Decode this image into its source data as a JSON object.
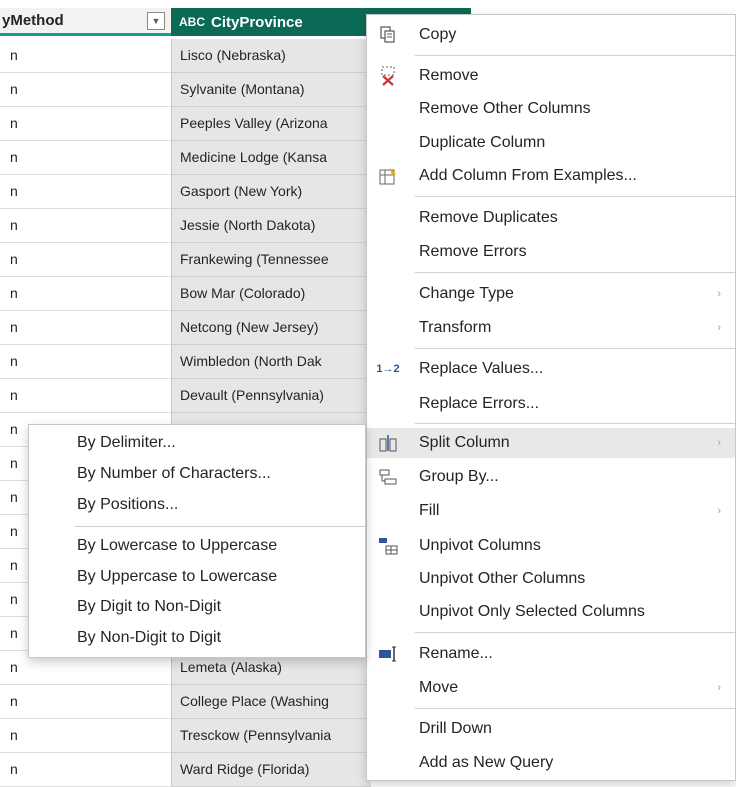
{
  "columns": {
    "col1_header": "yMethod",
    "col2_header": "CityProvince",
    "col2_type_icon": "ABC",
    "dropdown_glyph": "▼"
  },
  "rows": [
    {
      "c1": "n",
      "c2": "Lisco (Nebraska)"
    },
    {
      "c1": "n",
      "c2": "Sylvanite (Montana)"
    },
    {
      "c1": "n",
      "c2": "Peeples Valley (Arizona"
    },
    {
      "c1": "n",
      "c2": "Medicine Lodge (Kansa"
    },
    {
      "c1": "n",
      "c2": "Gasport (New York)"
    },
    {
      "c1": "n",
      "c2": "Jessie (North Dakota)"
    },
    {
      "c1": "n",
      "c2": "Frankewing (Tennessee"
    },
    {
      "c1": "n",
      "c2": "Bow Mar (Colorado)"
    },
    {
      "c1": "n",
      "c2": "Netcong (New Jersey)"
    },
    {
      "c1": "n",
      "c2": "Wimbledon (North Dak"
    },
    {
      "c1": "n",
      "c2": "Devault (Pennsylvania)"
    },
    {
      "c1": "n",
      "c2": ""
    },
    {
      "c1": "n",
      "c2": ""
    },
    {
      "c1": "n",
      "c2": ""
    },
    {
      "c1": "n",
      "c2": ""
    },
    {
      "c1": "n",
      "c2": ""
    },
    {
      "c1": "n",
      "c2": ""
    },
    {
      "c1": "n",
      "c2": ""
    },
    {
      "c1": "n",
      "c2": "Lemeta (Alaska)"
    },
    {
      "c1": "n",
      "c2": "College Place (Washing"
    },
    {
      "c1": "n",
      "c2": "Tresckow (Pennsylvania"
    },
    {
      "c1": "n",
      "c2": "Ward Ridge (Florida)"
    }
  ],
  "context_menu": {
    "items": [
      {
        "label": "Copy",
        "icon": "copy-icon"
      },
      {
        "label": "Remove",
        "icon": "remove-column-icon"
      },
      {
        "label": "Remove Other Columns",
        "icon": ""
      },
      {
        "label": "Duplicate Column",
        "icon": ""
      },
      {
        "label": "Add Column From Examples...",
        "icon": "add-column-examples-icon"
      },
      {
        "label": "Remove Duplicates",
        "icon": ""
      },
      {
        "label": "Remove Errors",
        "icon": ""
      },
      {
        "label": "Change Type",
        "icon": "",
        "submenu": true
      },
      {
        "label": "Transform",
        "icon": "",
        "submenu": true
      },
      {
        "label": "Replace Values...",
        "icon": "replace-values-icon"
      },
      {
        "label": "Replace Errors...",
        "icon": ""
      },
      {
        "label": "Split Column",
        "icon": "split-column-icon",
        "submenu": true
      },
      {
        "label": "Group By...",
        "icon": "group-by-icon"
      },
      {
        "label": "Fill",
        "icon": "",
        "submenu": true
      },
      {
        "label": "Unpivot Columns",
        "icon": "unpivot-icon"
      },
      {
        "label": "Unpivot Other Columns",
        "icon": ""
      },
      {
        "label": "Unpivot Only Selected Columns",
        "icon": ""
      },
      {
        "label": "Rename...",
        "icon": "rename-icon"
      },
      {
        "label": "Move",
        "icon": "",
        "submenu": true
      },
      {
        "label": "Drill Down",
        "icon": ""
      },
      {
        "label": "Add as New Query",
        "icon": ""
      }
    ],
    "submenu_arrow": "›",
    "replace_icon_text": "1→2"
  },
  "split_submenu": {
    "items": [
      "By Delimiter...",
      "By Number of Characters...",
      "By Positions...",
      "By Lowercase to Uppercase",
      "By Uppercase to Lowercase",
      "By Digit to Non-Digit",
      "By Non-Digit to Digit"
    ]
  }
}
